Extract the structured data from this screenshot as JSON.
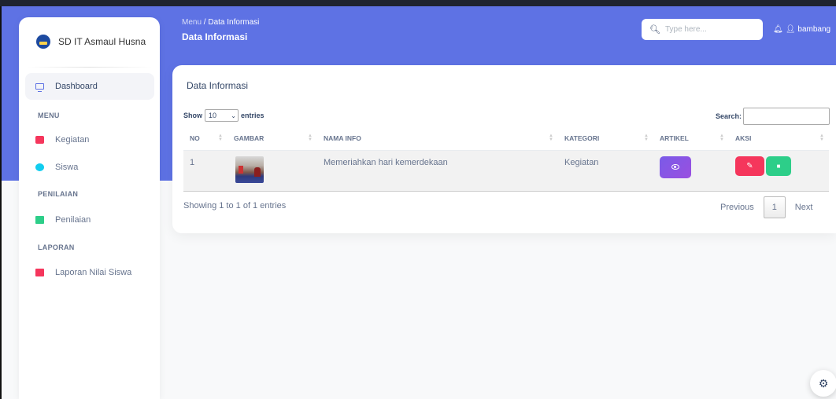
{
  "sidebar": {
    "brand": "SD IT Asmaul Husna",
    "items": [
      {
        "label": "Dashboard",
        "icon": "monitor-icon"
      },
      {
        "label": "Kegiatan",
        "icon": "calendar-icon"
      },
      {
        "label": "Siswa",
        "icon": "user-icon"
      },
      {
        "label": "Penilaian",
        "icon": "book-icon"
      },
      {
        "label": "Laporan Nilai Siswa",
        "icon": "pdf-icon"
      }
    ],
    "sections": [
      "MENU",
      "PENILAIAN",
      "LAPORAN"
    ]
  },
  "header": {
    "breadcrumb_root": "Menu",
    "breadcrumb_sep": "/",
    "breadcrumb_current": "Data Informasi",
    "title": "Data Informasi",
    "search_placeholder": "Type here...",
    "user_name": "bambang"
  },
  "card": {
    "title": "Data Informasi",
    "show_label": "Show",
    "length_value": "10",
    "entries_label": "entries",
    "search_label": "Search:",
    "columns": [
      "NO",
      "GAMBAR",
      "NAMA INFO",
      "KATEGORI",
      "ARTIKEL",
      "AKSI"
    ],
    "rows": [
      {
        "no": "1",
        "nama_info": "Memeriahkan hari kemerdekaan",
        "kategori": "Kegiatan"
      }
    ],
    "info_text": "Showing 1 to 1 of 1 entries",
    "pagination": {
      "previous": "Previous",
      "current": "1",
      "next": "Next"
    }
  },
  "colors": {
    "primary": "#5e72e4",
    "danger": "#f5365c",
    "success": "#2dce89",
    "purple": "#8a5ce6"
  }
}
